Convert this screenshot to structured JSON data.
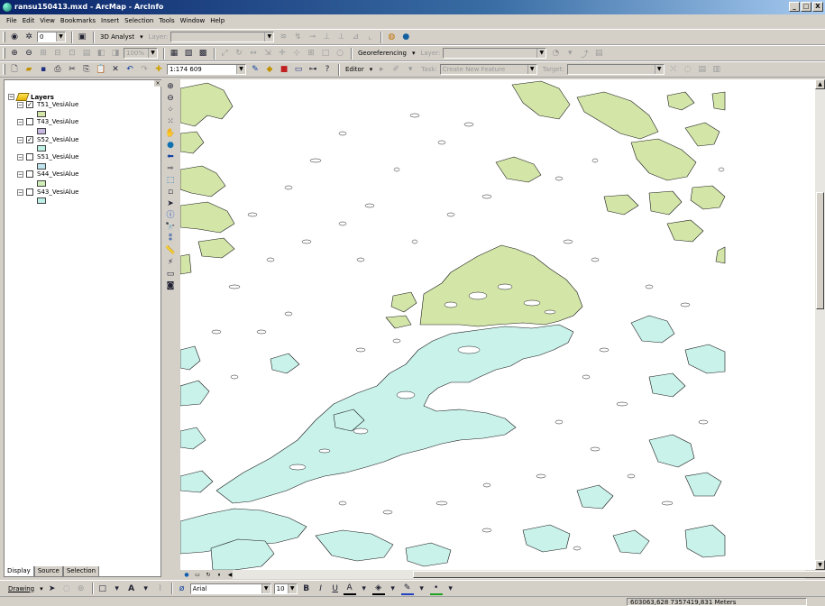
{
  "window": {
    "title": "ransu150413.mxd - ArcMap - ArcInfo",
    "minimize": "_",
    "maximize": "□",
    "close": "X"
  },
  "menubar": [
    "File",
    "Edit",
    "View",
    "Bookmarks",
    "Insert",
    "Selection",
    "Tools",
    "Window",
    "Help"
  ],
  "toolbar1": {
    "zoom_value": "0",
    "analyst_label": "3D Analyst",
    "layer_label": "Layer:"
  },
  "toolbar2": {
    "zoom_percent": "100%",
    "georef_label": "Georeferencing",
    "layer_label": "Layer:"
  },
  "toolbar3": {
    "scale_value": "1:174 609",
    "editor_label": "Editor",
    "task_label": "Task:",
    "task_value": "Create New Feature",
    "target_label": "Target:"
  },
  "toc": {
    "root_label": "Layers",
    "layers": [
      {
        "name": "T51_VesiAlue",
        "checked": true,
        "color": "#d3e6a8"
      },
      {
        "name": "T43_VesiAlue",
        "checked": false,
        "color": "#c7b8e0"
      },
      {
        "name": "S52_VesiAlue",
        "checked": true,
        "color": "#bff0e4"
      },
      {
        "name": "S51_VesiAlue",
        "checked": false,
        "color": "#bfe6f0"
      },
      {
        "name": "S44_VesiAlue",
        "checked": false,
        "color": "#d0f0b8"
      },
      {
        "name": "S43_VesiAlue",
        "checked": false,
        "color": "#bff0e8"
      }
    ],
    "tabs": [
      "Display",
      "Source",
      "Selection"
    ]
  },
  "drawing_toolbar": {
    "drawing_label": "Drawing",
    "font_name": "Arial",
    "font_size": "10",
    "bold": "B",
    "italic": "I",
    "underline": "U"
  },
  "status": {
    "coords": "603063,628  7357419,831 Meters"
  },
  "colors": {
    "upper_water": "#d3e6a8",
    "lower_water": "#c8f2ea",
    "outline": "#1a1a1a"
  }
}
